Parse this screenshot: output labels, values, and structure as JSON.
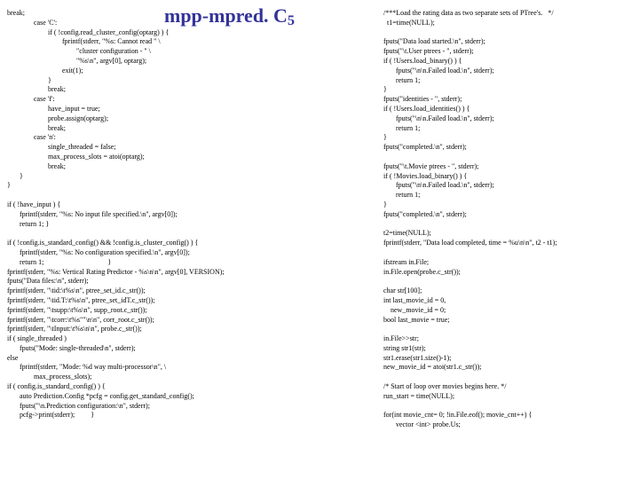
{
  "title_main": "mpp-mpred. C",
  "title_sub": "5",
  "left_code": "break;\n               case 'C':\n                       if ( !config.read_cluster_config(optarg) ) {\n                               fprintf(stderr, \"%s: Cannot read \" \\\n                                       \"cluster configuration - \" \\\n                                       \"%s\\n\", argv[0], optarg);\n                               exit(1);\n                       }\n                       break;\n               case 'f':\n                       have_input = true;\n                       probe.assign(optarg);\n                       break;\n               case 'n':\n                       single_threaded = false;\n                       max_process_slots = atoi(optarg);\n                       break;\n       }\n}\n\nif ( !have_input ) {\n       fprintf(stderr, \"%s: No input file specified.\\n\", argv[0]);\n       return 1; }\n\nif ( !config.is_standard_config() && !config.is_cluster_config() ) {\n       fprintf(stderr, \"%s: No configuration specified.\\n\", argv[0]);\n       return 1;                                    }\nfprintf(stderr, \"%s: Vertical Rating Predictor - %s\\n\\n\", argv[0], VERSION);\nfputs(\"Data files:\\n\", stderr);\nfprintf(stderr, \"\\tid:\\t%s\\n\", ptree_set_id.c_str());\nfprintf(stderr, \"\\tid.T:\\t%s\\n\", ptree_set_idT.c_str());\nfprintf(stderr, \"\\tsupp:\\t%s\\n\", supp_root.c_str());\nfprintf(stderr, \"\\tcorr:\\t%s\"\"\\n\\n\", corr_root.c_str());\nfprintf(stderr, \"\\tInput:\\t%s\\n\\n\", probe.c_str());\nif ( single_threaded )\n       fputs(\"Mode: single-threaded\\n\", stderr);\nelse\n       fprintf(stderr, \"Mode: %d way multi-processor\\n\", \\\n               max_process_slots);\nif ( config.is_standard_config() ) {\n       auto Prediction.Config *pcfg = config.get_standard_config();\n       fputs(\"\\n.Prediction configuration:\\n\", stderr);\n       pcfg->print(stderr);         }",
  "right_code": "/***Load the rating data as two separate sets of PTree's.   */\n  t1=time(NULL);\n\nfputs(\"Data load started.\\n\", stderr);\nfputs(\"\\t.User ptrees - \", stderr);\nif ( !Users.load_binary() ) {\n       fputs(\"\\n\\n.Failed load.\\n\", stderr);\n       return 1;\n}\nfputs(\"identities - \", stderr);\nif ( !Users.load_identities() ) {\n       fputs(\"\\n\\n.Failed load.\\n\", stderr);\n       return 1;\n}\nfputs(\"completed.\\n\", stderr);\n\nfputs(\"\\t.Movie ptrees - \", stderr);\nif ( !Movies.load_binary() ) {\n       fputs(\"\\n\\n.Failed load.\\n\", stderr);\n       return 1;\n}\nfputs(\"completed.\\n\", stderr);\n\nt2=time(NULL);\nfprintf(stderr, \"Data load completed, time = %u\\n\\n\", t2 - t1);\n\nifstream in.File;\nin.File.open(probe.c_str());\n\nchar str[100];\nint last_movie_id = 0,\n    new_movie_id = 0;\nbool last_movie = true;\n\nin.File>>str;\nstring str1(str);\nstr1.erase(str1.size()-1);\nnew_movie_id = atoi(str1.c_str());\n\n/* Start of loop over movies begins here. */\nrun_start = time(NULL);\n\nfor(int movie_cnt= 0; !in.File.eof(); movie_cnt++) {\n       vector <int> probe.Us;"
}
